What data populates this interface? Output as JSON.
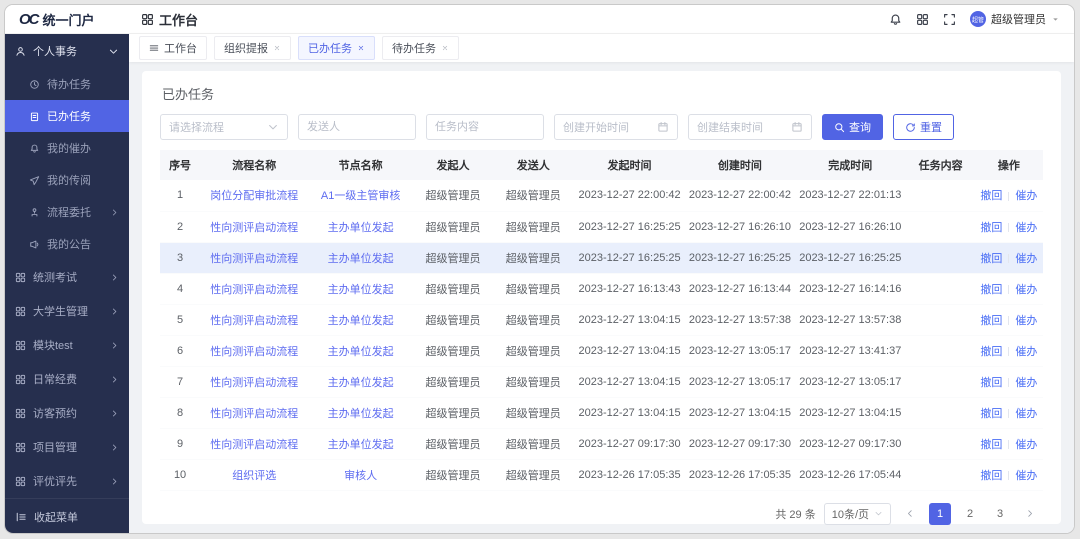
{
  "colors": {
    "accent": "#5164e4",
    "sidebar_bg": "#262f4e",
    "link": "#5e6cf0",
    "row_highlight": "#e9effc"
  },
  "header": {
    "logo_mark": "OC",
    "logo_title": "统一门户",
    "workspace_title": "工作台",
    "user_name": "超级管理员",
    "avatar_text": "超管",
    "icons": [
      "bell-icon",
      "apps-icon",
      "fullscreen-icon"
    ]
  },
  "tabs": [
    {
      "label": "工作台",
      "active": false,
      "closable": false,
      "icon": "menu-icon"
    },
    {
      "label": "组织提报",
      "active": false,
      "closable": true
    },
    {
      "label": "已办任务",
      "active": true,
      "closable": true
    },
    {
      "label": "待办任务",
      "active": false,
      "closable": true
    }
  ],
  "sidebar": {
    "group": {
      "label": "个人事务",
      "icon": "user-icon",
      "state": "expanded"
    },
    "personal_items": [
      {
        "label": "待办任务",
        "icon": "clock-icon",
        "active": false
      },
      {
        "label": "已办任务",
        "icon": "clipboard-icon",
        "active": true
      },
      {
        "label": "我的催办",
        "icon": "alarm-icon",
        "active": false
      },
      {
        "label": "我的传阅",
        "icon": "send-icon",
        "active": false
      },
      {
        "label": "流程委托",
        "icon": "org-icon",
        "active": false,
        "has_children": true
      },
      {
        "label": "我的公告",
        "icon": "megaphone-icon",
        "active": false
      }
    ],
    "modules": [
      {
        "label": "统测考试",
        "icon": "grid-icon"
      },
      {
        "label": "大学生管理",
        "icon": "grid-icon"
      },
      {
        "label": "模块test",
        "icon": "grid-icon"
      },
      {
        "label": "日常经费",
        "icon": "grid-icon"
      },
      {
        "label": "访客预约",
        "icon": "grid-icon"
      },
      {
        "label": "项目管理",
        "icon": "grid-icon"
      },
      {
        "label": "评优评先",
        "icon": "grid-icon"
      }
    ],
    "collapse_label": "收起菜单"
  },
  "panel": {
    "title": "已办任务",
    "filters": {
      "process_placeholder": "请选择流程",
      "sender_placeholder": "发送人",
      "content_placeholder": "任务内容",
      "start_placeholder": "创建开始时间",
      "end_placeholder": "创建结束时间",
      "search_label": "查询",
      "reset_label": "重置"
    },
    "table": {
      "headers": [
        "序号",
        "流程名称",
        "节点名称",
        "发起人",
        "发送人",
        "发起时间",
        "创建时间",
        "完成时间",
        "任务内容",
        "操作"
      ],
      "actions": [
        "撤回",
        "催办"
      ],
      "rows": [
        {
          "no": "1",
          "process": "岗位分配审批流程",
          "node": "A1一级主管审核",
          "initiator": "超级管理员",
          "sender": "超级管理员",
          "start": "2023-12-27 22:00:42",
          "created": "2023-12-27 22:00:42",
          "finished": "2023-12-27 22:01:13",
          "content": "",
          "highlight": false
        },
        {
          "no": "2",
          "process": "性向测评启动流程",
          "node": "主办单位发起",
          "initiator": "超级管理员",
          "sender": "超级管理员",
          "start": "2023-12-27 16:25:25",
          "created": "2023-12-27 16:26:10",
          "finished": "2023-12-27 16:26:10",
          "content": "",
          "highlight": false
        },
        {
          "no": "3",
          "process": "性向测评启动流程",
          "node": "主办单位发起",
          "initiator": "超级管理员",
          "sender": "超级管理员",
          "start": "2023-12-27 16:25:25",
          "created": "2023-12-27 16:25:25",
          "finished": "2023-12-27 16:25:25",
          "content": "",
          "highlight": true
        },
        {
          "no": "4",
          "process": "性向测评启动流程",
          "node": "主办单位发起",
          "initiator": "超级管理员",
          "sender": "超级管理员",
          "start": "2023-12-27 16:13:43",
          "created": "2023-12-27 16:13:44",
          "finished": "2023-12-27 16:14:16",
          "content": "",
          "highlight": false
        },
        {
          "no": "5",
          "process": "性向测评启动流程",
          "node": "主办单位发起",
          "initiator": "超级管理员",
          "sender": "超级管理员",
          "start": "2023-12-27 13:04:15",
          "created": "2023-12-27 13:57:38",
          "finished": "2023-12-27 13:57:38",
          "content": "",
          "highlight": false
        },
        {
          "no": "6",
          "process": "性向测评启动流程",
          "node": "主办单位发起",
          "initiator": "超级管理员",
          "sender": "超级管理员",
          "start": "2023-12-27 13:04:15",
          "created": "2023-12-27 13:05:17",
          "finished": "2023-12-27 13:41:37",
          "content": "",
          "highlight": false
        },
        {
          "no": "7",
          "process": "性向测评启动流程",
          "node": "主办单位发起",
          "initiator": "超级管理员",
          "sender": "超级管理员",
          "start": "2023-12-27 13:04:15",
          "created": "2023-12-27 13:05:17",
          "finished": "2023-12-27 13:05:17",
          "content": "",
          "highlight": false
        },
        {
          "no": "8",
          "process": "性向测评启动流程",
          "node": "主办单位发起",
          "initiator": "超级管理员",
          "sender": "超级管理员",
          "start": "2023-12-27 13:04:15",
          "created": "2023-12-27 13:04:15",
          "finished": "2023-12-27 13:04:15",
          "content": "",
          "highlight": false
        },
        {
          "no": "9",
          "process": "性向测评启动流程",
          "node": "主办单位发起",
          "initiator": "超级管理员",
          "sender": "超级管理员",
          "start": "2023-12-27 09:17:30",
          "created": "2023-12-27 09:17:30",
          "finished": "2023-12-27 09:17:30",
          "content": "",
          "highlight": false
        },
        {
          "no": "10",
          "process": "组织评选",
          "node": "审核人",
          "initiator": "超级管理员",
          "sender": "超级管理员",
          "start": "2023-12-26 17:05:35",
          "created": "2023-12-26 17:05:35",
          "finished": "2023-12-26 17:05:44",
          "content": "",
          "highlight": false
        }
      ]
    },
    "pagination": {
      "total": "共 29 条",
      "page_size": "10条/页",
      "pages": [
        "1",
        "2",
        "3"
      ],
      "active": "1"
    }
  }
}
